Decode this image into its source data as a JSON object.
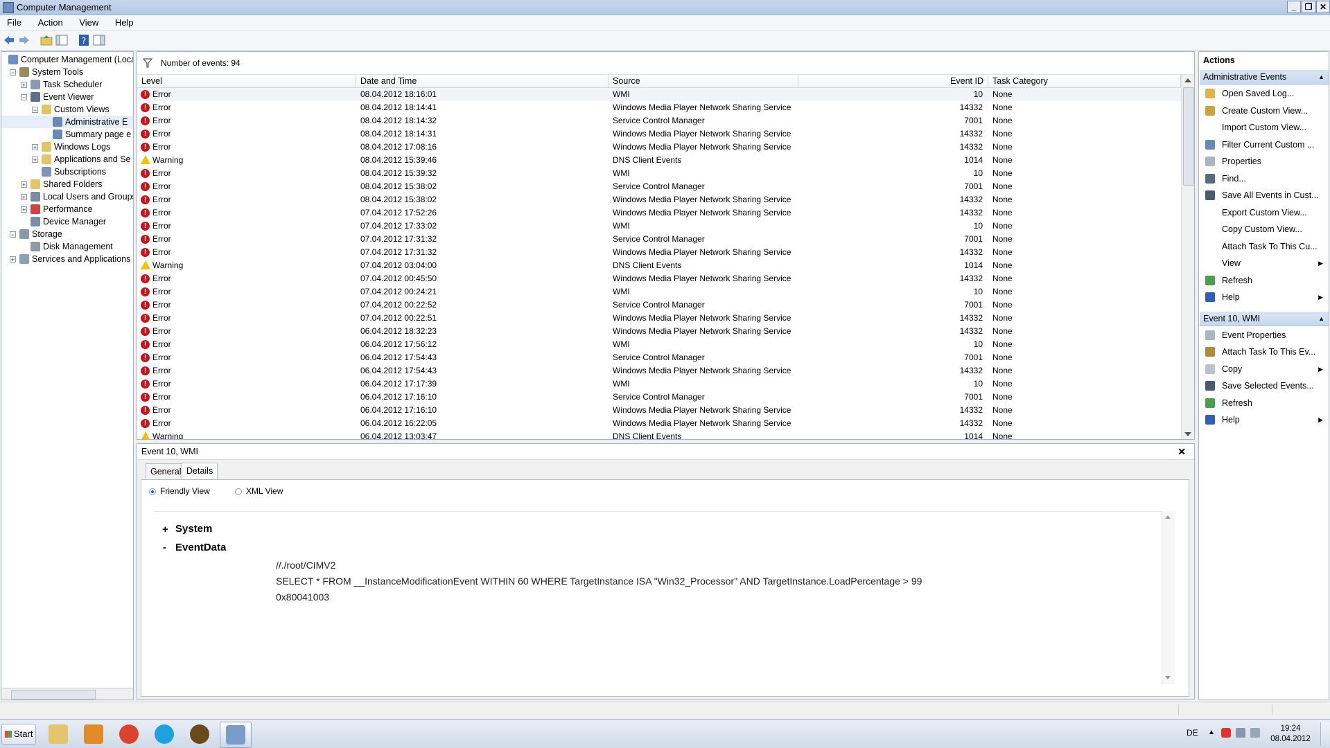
{
  "window": {
    "title": "Computer Management",
    "controls": [
      "_",
      "❐",
      "✕"
    ]
  },
  "menu": [
    "File",
    "Action",
    "View",
    "Help"
  ],
  "tree": [
    {
      "label": "Computer Management (Local",
      "level": 0,
      "expander": "",
      "icon": "computer-management-icon",
      "color": "#6e8fbf"
    },
    {
      "label": "System Tools",
      "level": 1,
      "expander": "−",
      "icon": "tools-icon",
      "color": "#9a8b5a"
    },
    {
      "label": "Task Scheduler",
      "level": 2,
      "expander": "+",
      "icon": "clock-icon",
      "color": "#8a9bb0"
    },
    {
      "label": "Event Viewer",
      "level": 2,
      "expander": "−",
      "icon": "event-viewer-icon",
      "color": "#5d6f8a"
    },
    {
      "label": "Custom Views",
      "level": 3,
      "expander": "−",
      "icon": "folder-icon",
      "color": "#e2c46a"
    },
    {
      "label": "Administrative E",
      "level": 4,
      "expander": "",
      "icon": "filter-icon",
      "color": "#6b87b5",
      "selected": true
    },
    {
      "label": "Summary page e",
      "level": 4,
      "expander": "",
      "icon": "filter-icon",
      "color": "#6b87b5"
    },
    {
      "label": "Windows Logs",
      "level": 3,
      "expander": "+",
      "icon": "folder-icon",
      "color": "#e2c46a"
    },
    {
      "label": "Applications and Se",
      "level": 3,
      "expander": "+",
      "icon": "folder-icon",
      "color": "#e2c46a"
    },
    {
      "label": "Subscriptions",
      "level": 3,
      "expander": "",
      "icon": "subscriptions-icon",
      "color": "#7f95b7"
    },
    {
      "label": "Shared Folders",
      "level": 2,
      "expander": "+",
      "icon": "shared-folder-icon",
      "color": "#e2c46a"
    },
    {
      "label": "Local Users and Groups",
      "level": 2,
      "expander": "+",
      "icon": "users-icon",
      "color": "#7a8aa0"
    },
    {
      "label": "Performance",
      "level": 2,
      "expander": "+",
      "icon": "performance-icon",
      "color": "#c44"
    },
    {
      "label": "Device Manager",
      "level": 2,
      "expander": "",
      "icon": "device-manager-icon",
      "color": "#7b8ea8"
    },
    {
      "label": "Storage",
      "level": 1,
      "expander": "−",
      "icon": "storage-icon",
      "color": "#8899aa"
    },
    {
      "label": "Disk Management",
      "level": 2,
      "expander": "",
      "icon": "disk-icon",
      "color": "#909aa6"
    },
    {
      "label": "Services and Applications",
      "level": 1,
      "expander": "+",
      "icon": "services-icon",
      "color": "#8aa0b5"
    }
  ],
  "events_header": {
    "text": "Number of events: 94"
  },
  "columns": [
    "Level",
    "Date and Time",
    "Source",
    "Event ID",
    "Task Category"
  ],
  "events": [
    {
      "level": "Error",
      "date": "08.04.2012 18:16:01",
      "source": "WMI",
      "id": "10",
      "cat": "None"
    },
    {
      "level": "Error",
      "date": "08.04.2012 18:14:41",
      "source": "Windows Media Player Network Sharing Service",
      "id": "14332",
      "cat": "None"
    },
    {
      "level": "Error",
      "date": "08.04.2012 18:14:32",
      "source": "Service Control Manager",
      "id": "7001",
      "cat": "None"
    },
    {
      "level": "Error",
      "date": "08.04.2012 18:14:31",
      "source": "Windows Media Player Network Sharing Service",
      "id": "14332",
      "cat": "None"
    },
    {
      "level": "Error",
      "date": "08.04.2012 17:08:16",
      "source": "Windows Media Player Network Sharing Service",
      "id": "14332",
      "cat": "None"
    },
    {
      "level": "Warning",
      "date": "08.04.2012 15:39:46",
      "source": "DNS Client Events",
      "id": "1014",
      "cat": "None"
    },
    {
      "level": "Error",
      "date": "08.04.2012 15:39:32",
      "source": "WMI",
      "id": "10",
      "cat": "None"
    },
    {
      "level": "Error",
      "date": "08.04.2012 15:38:02",
      "source": "Service Control Manager",
      "id": "7001",
      "cat": "None"
    },
    {
      "level": "Error",
      "date": "08.04.2012 15:38:02",
      "source": "Windows Media Player Network Sharing Service",
      "id": "14332",
      "cat": "None"
    },
    {
      "level": "Error",
      "date": "07.04.2012 17:52:26",
      "source": "Windows Media Player Network Sharing Service",
      "id": "14332",
      "cat": "None"
    },
    {
      "level": "Error",
      "date": "07.04.2012 17:33:02",
      "source": "WMI",
      "id": "10",
      "cat": "None"
    },
    {
      "level": "Error",
      "date": "07.04.2012 17:31:32",
      "source": "Service Control Manager",
      "id": "7001",
      "cat": "None"
    },
    {
      "level": "Error",
      "date": "07.04.2012 17:31:32",
      "source": "Windows Media Player Network Sharing Service",
      "id": "14332",
      "cat": "None"
    },
    {
      "level": "Warning",
      "date": "07.04.2012 03:04:00",
      "source": "DNS Client Events",
      "id": "1014",
      "cat": "None"
    },
    {
      "level": "Error",
      "date": "07.04.2012 00:45:50",
      "source": "Windows Media Player Network Sharing Service",
      "id": "14332",
      "cat": "None"
    },
    {
      "level": "Error",
      "date": "07.04.2012 00:24:21",
      "source": "WMI",
      "id": "10",
      "cat": "None"
    },
    {
      "level": "Error",
      "date": "07.04.2012 00:22:52",
      "source": "Service Control Manager",
      "id": "7001",
      "cat": "None"
    },
    {
      "level": "Error",
      "date": "07.04.2012 00:22:51",
      "source": "Windows Media Player Network Sharing Service",
      "id": "14332",
      "cat": "None"
    },
    {
      "level": "Error",
      "date": "06.04.2012 18:32:23",
      "source": "Windows Media Player Network Sharing Service",
      "id": "14332",
      "cat": "None"
    },
    {
      "level": "Error",
      "date": "06.04.2012 17:56:12",
      "source": "WMI",
      "id": "10",
      "cat": "None"
    },
    {
      "level": "Error",
      "date": "06.04.2012 17:54:43",
      "source": "Service Control Manager",
      "id": "7001",
      "cat": "None"
    },
    {
      "level": "Error",
      "date": "06.04.2012 17:54:43",
      "source": "Windows Media Player Network Sharing Service",
      "id": "14332",
      "cat": "None"
    },
    {
      "level": "Error",
      "date": "06.04.2012 17:17:39",
      "source": "WMI",
      "id": "10",
      "cat": "None"
    },
    {
      "level": "Error",
      "date": "06.04.2012 17:16:10",
      "source": "Service Control Manager",
      "id": "7001",
      "cat": "None"
    },
    {
      "level": "Error",
      "date": "06.04.2012 17:16:10",
      "source": "Windows Media Player Network Sharing Service",
      "id": "14332",
      "cat": "None"
    },
    {
      "level": "Error",
      "date": "06.04.2012 16:22:05",
      "source": "Windows Media Player Network Sharing Service",
      "id": "14332",
      "cat": "None"
    },
    {
      "level": "Warning",
      "date": "06.04.2012 13:03:47",
      "source": "DNS Client Events",
      "id": "1014",
      "cat": "None"
    }
  ],
  "details": {
    "title": "Event 10, WMI",
    "close": "✕",
    "tabs": [
      "General",
      "Details"
    ],
    "view_options": [
      "Friendly View",
      "XML View"
    ],
    "system_label": "System",
    "system_toggle": "+",
    "eventdata_label": "EventData",
    "eventdata_toggle": "-",
    "lines": [
      "//./root/CIMV2",
      "SELECT * FROM __InstanceModificationEvent WITHIN 60 WHERE TargetInstance ISA \"Win32_Processor\" AND TargetInstance.LoadPercentage > 99",
      "0x80041003"
    ]
  },
  "actions": {
    "title": "Actions",
    "sections": [
      {
        "header": "Administrative Events",
        "items": [
          {
            "label": "Open Saved Log...",
            "icon": "open-log-icon",
            "color": "#e0b24a"
          },
          {
            "label": "Create Custom View...",
            "icon": "create-view-icon",
            "color": "#c9a43a"
          },
          {
            "label": "Import Custom View...",
            "icon": "",
            "color": ""
          },
          {
            "label": "Filter Current Custom ...",
            "icon": "filter-icon",
            "color": "#6b87b5"
          },
          {
            "label": "Properties",
            "icon": "properties-icon",
            "color": "#aab4c2"
          },
          {
            "label": "Find...",
            "icon": "find-icon",
            "color": "#5a6a80"
          },
          {
            "label": "Save All Events in Cust...",
            "icon": "save-icon",
            "color": "#4a5a70"
          },
          {
            "label": "Export Custom View...",
            "icon": "",
            "color": ""
          },
          {
            "label": "Copy Custom View...",
            "icon": "",
            "color": ""
          },
          {
            "label": "Attach Task To This Cu...",
            "icon": "",
            "color": ""
          },
          {
            "label": "View",
            "icon": "",
            "color": "",
            "submenu": "▶"
          },
          {
            "label": "Refresh",
            "icon": "refresh-icon",
            "color": "#4aa04a"
          },
          {
            "label": "Help",
            "icon": "help-icon",
            "color": "#2f5fb0",
            "submenu": "▶"
          }
        ]
      },
      {
        "header": "Event 10, WMI",
        "items": [
          {
            "label": "Event Properties",
            "icon": "event-properties-icon",
            "color": "#aab4c2"
          },
          {
            "label": "Attach Task To This Ev...",
            "icon": "attach-task-icon",
            "color": "#b08a3a"
          },
          {
            "label": "Copy",
            "icon": "copy-icon",
            "color": "#b9c2cf",
            "submenu": "▶"
          },
          {
            "label": "Save Selected Events...",
            "icon": "save-icon",
            "color": "#4a5a70"
          },
          {
            "label": "Refresh",
            "icon": "refresh-icon",
            "color": "#4aa04a"
          },
          {
            "label": "Help",
            "icon": "help-icon",
            "color": "#2f5fb0",
            "submenu": "▶"
          }
        ]
      }
    ]
  },
  "taskbar": {
    "start_label": "Start",
    "apps": [
      {
        "name": "explorer-icon",
        "color": "#e4c46c"
      },
      {
        "name": "media-player-icon",
        "color": "#e08a2a"
      },
      {
        "name": "chrome-icon",
        "color": "#d9442e"
      },
      {
        "name": "skype-icon",
        "color": "#1ea1e0"
      },
      {
        "name": "warcraft-icon",
        "color": "#6a4a1a"
      },
      {
        "name": "computer-management-icon",
        "color": "#7c9bc8"
      }
    ],
    "lang": "DE",
    "time": "19:24",
    "date": "08.04.2012"
  },
  "colors": {
    "error": "#c4161c",
    "warning": "#f2c200",
    "selection": "#cde0f7",
    "accent": "#3c6db5"
  }
}
